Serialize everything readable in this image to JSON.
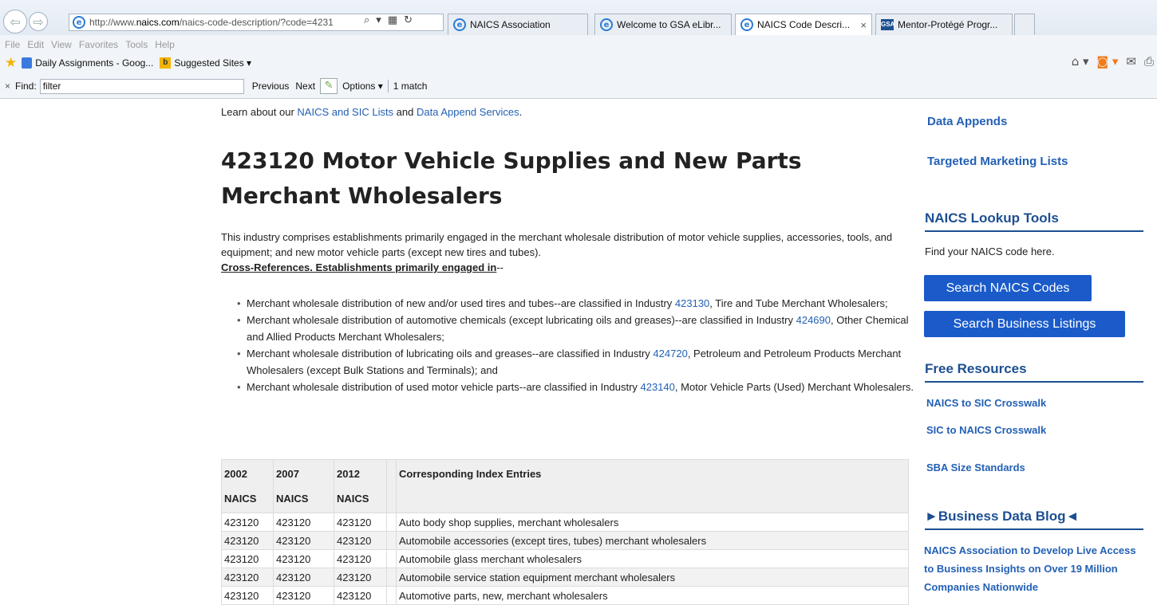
{
  "browser": {
    "address_prefix": "http://www.",
    "address_domain": "naics.com",
    "address_rest": "/naics-code-description/?code=4231",
    "tabs": [
      {
        "label": "NAICS Association"
      },
      {
        "label": "Welcome to GSA eLibr..."
      },
      {
        "label": "NAICS Code Descri...",
        "active": true
      },
      {
        "label": "Mentor-Protégé Progr..."
      }
    ],
    "menu": [
      "File",
      "Edit",
      "View",
      "Favorites",
      "Tools",
      "Help"
    ],
    "favorites": [
      "Daily Assignments - Goog...",
      "Suggested Sites ▾"
    ],
    "find": {
      "label": "Find:",
      "value": "filter",
      "previous": "Previous",
      "next": "Next",
      "options": "Options ▾",
      "matches": "1 match"
    }
  },
  "page": {
    "learn_prefix": "Learn about our ",
    "learn_link1": "NAICS and SIC Lists",
    "learn_mid": " and ",
    "learn_link2": "Data Append Services",
    "learn_suffix": ".",
    "title": "423120 Motor Vehicle Supplies and New Parts Merchant Wholesalers",
    "description": "This industry comprises establishments primarily engaged in the merchant wholesale distribution of motor vehicle supplies, accessories, tools, and equipment; and new motor vehicle parts (except new tires and tubes).",
    "xref_label": "Cross-References. Establishments primarily engaged in",
    "xref_suffix": "--",
    "bullets": [
      {
        "pre": "Merchant wholesale distribution of new and/or used tires and tubes--are classified in Industry ",
        "code": "423130",
        "post": ", Tire and Tube Merchant Wholesalers;"
      },
      {
        "pre": "Merchant wholesale distribution of automotive chemicals (except lubricating oils and greases)--are classified in Industry ",
        "code": "424690",
        "post": ", Other Chemical and Allied Products Merchant Wholesalers;"
      },
      {
        "pre": "Merchant wholesale distribution of lubricating oils and greases--are classified in Industry ",
        "code": "424720",
        "post": ", Petroleum and Petroleum Products Merchant Wholesalers (except Bulk Stations and Terminals); and"
      },
      {
        "pre": "Merchant wholesale distribution of used motor vehicle parts--are classified in Industry ",
        "code": "423140",
        "post": ", Motor Vehicle Parts (Used) Merchant Wholesalers."
      }
    ],
    "table": {
      "headers": [
        {
          "line1": "2002",
          "line2": "NAICS"
        },
        {
          "line1": "2007",
          "line2": "NAICS"
        },
        {
          "line1": "2012",
          "line2": "NAICS"
        },
        {
          "line1": "",
          "line2": ""
        },
        {
          "line1": "Corresponding Index Entries",
          "line2": ""
        }
      ],
      "rows": [
        [
          "423120",
          "423120",
          "423120",
          "Auto body shop supplies, merchant wholesalers"
        ],
        [
          "423120",
          "423120",
          "423120",
          "Automobile accessories (except tires, tubes) merchant wholesalers"
        ],
        [
          "423120",
          "423120",
          "423120",
          "Automobile glass merchant wholesalers"
        ],
        [
          "423120",
          "423120",
          "423120",
          "Automobile service station equipment merchant wholesalers"
        ],
        [
          "423120",
          "423120",
          "423120",
          "Automotive parts, new, merchant wholesalers"
        ]
      ]
    }
  },
  "sidebar": {
    "link1": "Data Appends",
    "link2": "Targeted Marketing Lists",
    "lookup_heading": "NAICS Lookup Tools",
    "lookup_text": "Find your NAICS code here.",
    "btn_search_codes": "Search NAICS Codes",
    "btn_search_business": "Search Business  Listings",
    "free_heading": "Free Resources",
    "res1": "NAICS to SIC Crosswalk",
    "res2": "SIC to NAICS Crosswalk",
    "res3": "SBA Size Standards",
    "blog_heading": "►Business Data Blog◄",
    "blog_post": "NAICS Association to Develop Live Access to Business Insights on Over 19 Million Companies Nationwide"
  }
}
